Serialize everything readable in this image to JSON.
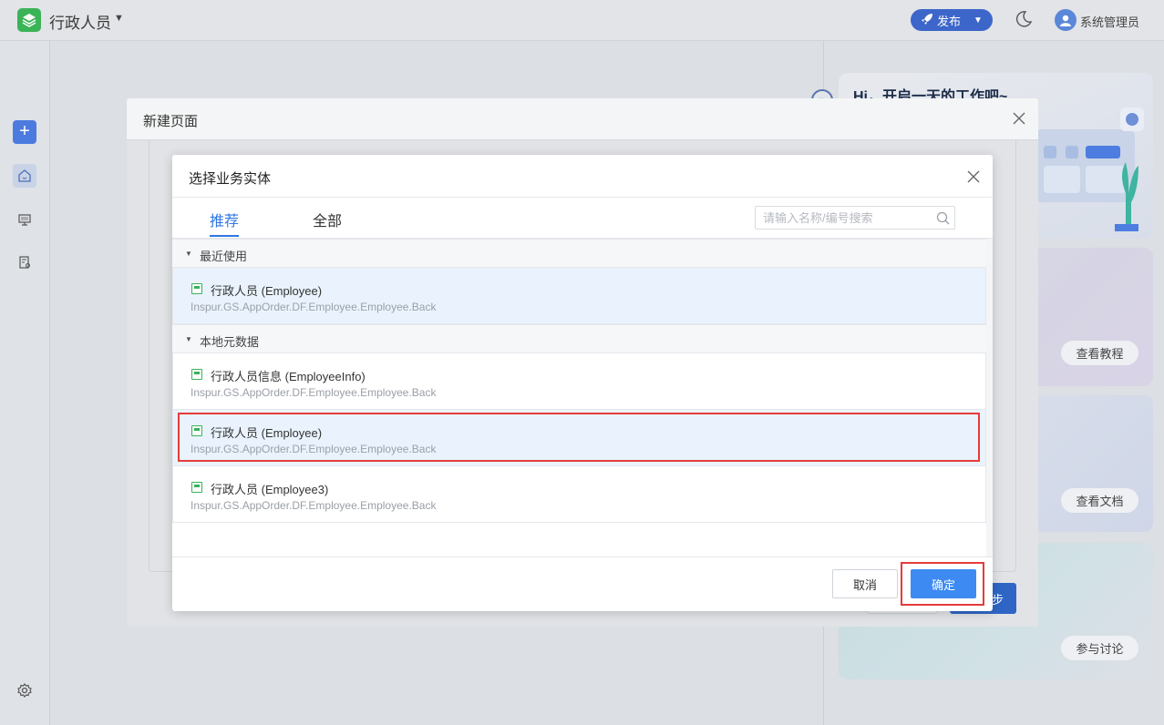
{
  "topbar": {
    "app_title": "行政人员",
    "publish_label": "发布",
    "user_name": "系统管理员"
  },
  "right_panel": {
    "greeting": "Hi，开启一天的工作吧~",
    "tutorial_label": "查看教程",
    "docs_label": "查看文档",
    "discuss_label": "参与讨论"
  },
  "outer_modal": {
    "title": "新建页面",
    "next_label_partial": "步"
  },
  "dialog": {
    "title": "选择业务实体",
    "tabs": [
      "推荐",
      "全部"
    ],
    "search_placeholder": "请输入名称/编号搜索",
    "groups": [
      {
        "label": "最近使用",
        "items": [
          {
            "name": "行政人员 (Employee)",
            "code": "Inspur.GS.AppOrder.DF.Employee.Employee.Back",
            "selected": true
          }
        ]
      },
      {
        "label": "本地元数据",
        "items": [
          {
            "name": "行政人员信息 (EmployeeInfo)",
            "code": "Inspur.GS.AppOrder.DF.Employee.Employee.Back",
            "selected": false
          },
          {
            "name": "行政人员 (Employee)",
            "code": "Inspur.GS.AppOrder.DF.Employee.Employee.Back",
            "selected": true
          },
          {
            "name": "行政人员 (Employee3)",
            "code": "Inspur.GS.AppOrder.DF.Employee.Employee.Back",
            "selected": false
          }
        ]
      }
    ],
    "cancel_label": "取消",
    "ok_label": "确定"
  },
  "colors": {
    "accent": "#3d8bf2",
    "tab_active": "#2f76e6",
    "entity_icon": "#38b25a",
    "highlight_box": "#e53b3b"
  },
  "icons": [
    "layers-icon",
    "caret-down-icon",
    "rocket-icon",
    "moon-icon",
    "user-icon",
    "plus-icon",
    "home-icon",
    "monitor-icon",
    "document-icon",
    "gear-icon",
    "close-icon",
    "search-icon",
    "entity-icon",
    "expand-icon"
  ]
}
